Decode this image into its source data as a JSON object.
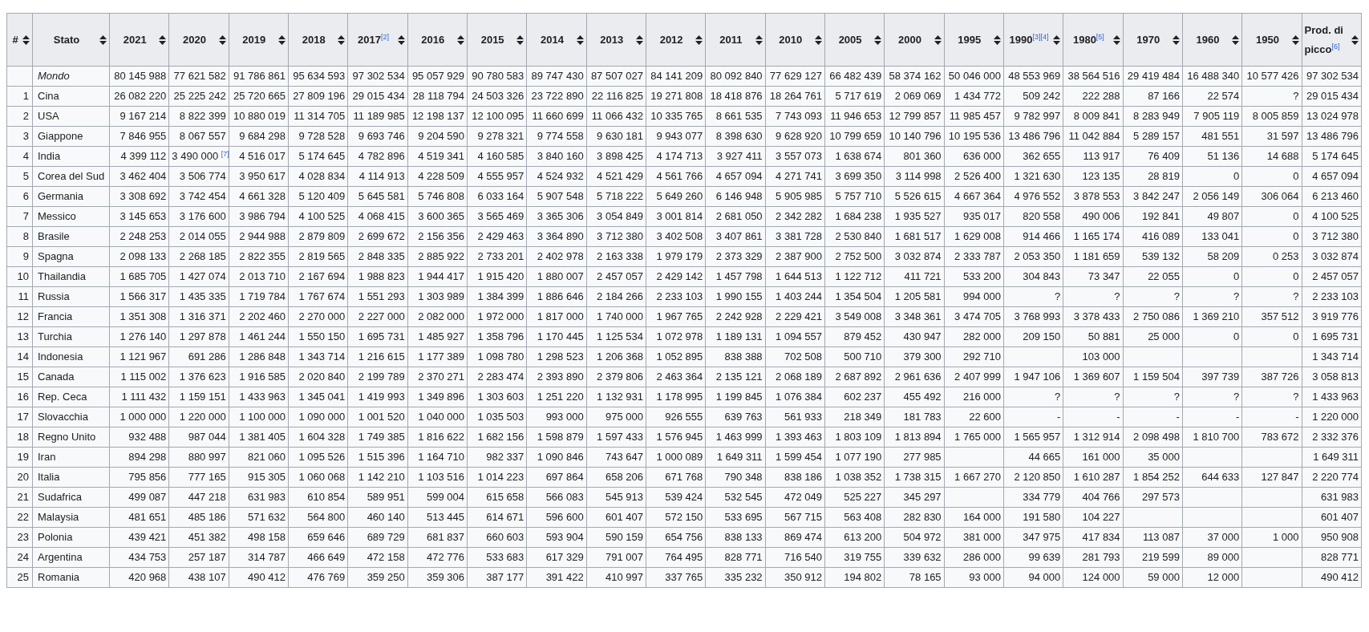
{
  "table": {
    "columns": [
      "#",
      "Stato",
      "2021",
      "2020",
      "2019",
      "2018",
      "2017$^{[2]}$",
      "2016",
      "2015",
      "2014",
      "2013",
      "2012",
      "2011",
      "2010",
      "2005",
      "2000",
      "1995",
      "1990$^{[3][4]}$",
      "1980$^{[5]}$",
      "1970",
      "1960",
      "1950",
      "Prod. di picco$^{[6]}$"
    ],
    "rows": [
      {
        "kind": "total",
        "country": "Mondo",
        "values": {
          "0": "80 145 988",
          "1": "77 621 582",
          "2": "91 786 861",
          "3": "95 634 593",
          "4": "97 302 534",
          "5": "95 057 929",
          "6": "90 780 583",
          "7": "89 747 430",
          "8": "87 507 027",
          "9": "84 141 209",
          "10": "80 092 840",
          "11": "77 629 127",
          "12": "66 482 439",
          "13": "58 374 162",
          "14": "50 046 000",
          "15": "48 553 969",
          "16": "38 564 516",
          "17": "29 419 484",
          "18": "16 488 340",
          "19": "10 577 426",
          "20": "97 302 534"
        }
      },
      {
        "kind": "country",
        "rank": "1",
        "country": "Cina",
        "values": {
          "0": "26 082 220",
          "1": "25 225 242",
          "2": "25 720 665",
          "3": "27 809 196",
          "4": "29 015 434",
          "5": "28 118 794",
          "6": "24 503 326",
          "7": "23 722 890",
          "8": "22 116 825",
          "9": "19 271 808",
          "10": "18 418 876",
          "11": "18 264 761",
          "12": "5 717 619",
          "13": "2 069 069",
          "14": "1 434 772",
          "15": "509 242",
          "16": "222 288",
          "17": "87 166",
          "18": "22 574",
          "19": "?",
          "20": "29 015 434"
        }
      },
      {
        "kind": "country",
        "rank": "2",
        "country": "USA",
        "values": {
          "0": "9 167 214",
          "1": "8 822 399",
          "2": "10 880 019",
          "3": "11 314 705",
          "4": "11 189 985",
          "5": "12 198 137",
          "6": "12 100 095",
          "7": "11 660 699",
          "8": "11 066 432",
          "9": "10 335 765",
          "10": "8 661 535",
          "11": "7 743 093",
          "12": "11 946 653",
          "13": "12 799 857",
          "14": "11 985 457",
          "15": "9 782 997",
          "16": "8 009 841",
          "17": "8 283 949",
          "18": "7 905 119",
          "19": "8 005 859",
          "20": "13 024 978"
        }
      },
      {
        "kind": "country",
        "rank": "3",
        "country": "Giappone",
        "values": {
          "0": "7 846 955",
          "1": "8 067 557",
          "2": "9 684 298",
          "3": "9 728 528",
          "4": "9 693 746",
          "5": "9 204 590",
          "6": "9 278 321",
          "7": "9 774 558",
          "8": "9 630 181",
          "9": "9 943 077",
          "10": "8 398 630",
          "11": "9 628 920",
          "12": "10 799 659",
          "13": "10 140 796",
          "14": "10 195 536",
          "15": "13 486 796",
          "16": "11 042 884",
          "17": "5 289 157",
          "18": "481 551",
          "19": "31 597",
          "20": "13 486 796"
        }
      },
      {
        "kind": "country",
        "rank": "4",
        "country": "India",
        "values": {
          "0": "4 399 112",
          "1": "3 490 000 $^{[7]}$",
          "2": "4 516 017",
          "3": "5 174 645",
          "4": "4 782 896",
          "5": "4 519 341",
          "6": "4 160 585",
          "7": "3 840 160",
          "8": "3 898 425",
          "9": "4 174 713",
          "10": "3 927 411",
          "11": "3 557 073",
          "12": "1 638 674",
          "13": "801 360",
          "14": "636 000",
          "15": "362 655",
          "16": "113 917",
          "17": "76 409",
          "18": "51 136",
          "19": "14 688",
          "20": "5 174 645"
        }
      },
      {
        "kind": "country",
        "rank": "5",
        "country": "Corea del Sud",
        "values": {
          "0": "3 462 404",
          "1": "3 506 774",
          "2": "3 950 617",
          "3": "4 028 834",
          "4": "4 114 913",
          "5": "4 228 509",
          "6": "4 555 957",
          "7": "4 524 932",
          "8": "4 521 429",
          "9": "4 561 766",
          "10": "4 657 094",
          "11": "4 271 741",
          "12": "3 699 350",
          "13": "3 114 998",
          "14": "2 526 400",
          "15": "1 321 630",
          "16": "123 135",
          "17": "28 819",
          "18": "0",
          "19": "0",
          "20": "4 657 094"
        }
      },
      {
        "kind": "country",
        "rank": "6",
        "country": "Germania",
        "values": {
          "0": "3 308 692",
          "1": "3 742 454",
          "2": "4 661 328",
          "3": "5 120 409",
          "4": "5 645 581",
          "5": "5 746 808",
          "6": "6 033 164",
          "7": "5 907 548",
          "8": "5 718 222",
          "9": "5 649 260",
          "10": "6 146 948",
          "11": "5 905 985",
          "12": "5 757 710",
          "13": "5 526 615",
          "14": "4 667 364",
          "15": "4 976 552",
          "16": "3 878 553",
          "17": "3 842 247",
          "18": "2 056 149",
          "19": "306 064",
          "20": "6 213 460"
        }
      },
      {
        "kind": "country",
        "rank": "7",
        "country": "Messico",
        "values": {
          "0": "3 145 653",
          "1": "3 176 600",
          "2": "3 986 794",
          "3": "4 100 525",
          "4": "4 068 415",
          "5": "3 600 365",
          "6": "3 565 469",
          "7": "3 365 306",
          "8": "3 054 849",
          "9": "3 001 814",
          "10": "2 681 050",
          "11": "2 342 282",
          "12": "1 684 238",
          "13": "1 935 527",
          "14": "935 017",
          "15": "820 558",
          "16": "490 006",
          "17": "192 841",
          "18": "49 807",
          "19": "0",
          "20": "4 100 525"
        }
      },
      {
        "kind": "country",
        "rank": "8",
        "country": "Brasile",
        "values": {
          "0": "2 248 253",
          "1": "2 014 055",
          "2": "2 944 988",
          "3": "2 879 809",
          "4": "2 699 672",
          "5": "2 156 356",
          "6": "2 429 463",
          "7": "3 364 890",
          "8": "3 712 380",
          "9": "3 402 508",
          "10": "3 407 861",
          "11": "3 381 728",
          "12": "2 530 840",
          "13": "1 681 517",
          "14": "1 629 008",
          "15": "914 466",
          "16": "1 165 174",
          "17": "416 089",
          "18": "133 041",
          "19": "0",
          "20": "3 712 380"
        }
      },
      {
        "kind": "country",
        "rank": "9",
        "country": "Spagna",
        "values": {
          "0": "2 098 133",
          "1": "2 268 185",
          "2": "2 822 355",
          "3": "2 819 565",
          "4": "2 848 335",
          "5": "2 885 922",
          "6": "2 733 201",
          "7": "2 402 978",
          "8": "2 163 338",
          "9": "1 979 179",
          "10": "2 373 329",
          "11": "2 387 900",
          "12": "2 752 500",
          "13": "3 032 874",
          "14": "2 333 787",
          "15": "2 053 350",
          "16": "1 181 659",
          "17": "539 132",
          "18": "58 209",
          "19": "0 253",
          "20": "3 032 874"
        }
      },
      {
        "kind": "country",
        "rank": "10",
        "country": "Thailandia",
        "values": {
          "0": "1 685 705",
          "1": "1 427 074",
          "2": "2 013 710",
          "3": "2 167 694",
          "4": "1 988 823",
          "5": "1 944 417",
          "6": "1 915 420",
          "7": "1 880 007",
          "8": "2 457 057",
          "9": "2 429 142",
          "10": "1 457 798",
          "11": "1 644 513",
          "12": "1 122 712",
          "13": "411 721",
          "14": "533 200",
          "15": "304 843",
          "16": "73 347",
          "17": "22 055",
          "18": "0",
          "19": "0",
          "20": "2 457 057"
        }
      },
      {
        "kind": "country",
        "rank": "11",
        "country": "Russia",
        "values": {
          "0": "1 566 317",
          "1": "1 435 335",
          "2": "1 719 784",
          "3": "1 767 674",
          "4": "1 551 293",
          "5": "1 303 989",
          "6": "1 384 399",
          "7": "1 886 646",
          "8": "2 184 266",
          "9": "2 233 103",
          "10": "1 990 155",
          "11": "1 403 244",
          "12": "1 354 504",
          "13": "1 205 581",
          "14": "994 000",
          "15": "?",
          "16": "?",
          "17": "?",
          "18": "?",
          "19": "?",
          "20": "2 233 103"
        }
      },
      {
        "kind": "country",
        "rank": "12",
        "country": "Francia",
        "values": {
          "0": "1 351 308",
          "1": "1 316 371",
          "2": "2 202 460",
          "3": "2 270 000",
          "4": "2 227 000",
          "5": "2 082 000",
          "6": "1 972 000",
          "7": "1 817 000",
          "8": "1 740 000",
          "9": "1 967 765",
          "10": "2 242 928",
          "11": "2 229 421",
          "12": "3 549 008",
          "13": "3 348 361",
          "14": "3 474 705",
          "15": "3 768 993",
          "16": "3 378 433",
          "17": "2 750 086",
          "18": "1 369 210",
          "19": "357 512",
          "20": "3 919 776"
        }
      },
      {
        "kind": "country",
        "rank": "13",
        "country": "Turchia",
        "values": {
          "0": "1 276 140",
          "1": "1 297 878",
          "2": "1 461 244",
          "3": "1 550 150",
          "4": "1 695 731",
          "5": "1 485 927",
          "6": "1 358 796",
          "7": "1 170 445",
          "8": "1 125 534",
          "9": "1 072 978",
          "10": "1 189 131",
          "11": "1 094 557",
          "12": "879 452",
          "13": "430 947",
          "14": "282 000",
          "15": "209 150",
          "16": "50 881",
          "17": "25 000",
          "18": "0",
          "19": "0",
          "20": "1 695 731"
        }
      },
      {
        "kind": "country",
        "rank": "14",
        "country": "Indonesia",
        "values": {
          "0": "1 121 967",
          "1": "691 286",
          "2": "1 286 848",
          "3": "1 343 714",
          "4": "1 216 615",
          "5": "1 177 389",
          "6": "1 098 780",
          "7": "1 298 523",
          "8": "1 206 368",
          "9": "1 052 895",
          "10": "838 388",
          "11": "702 508",
          "12": "500 710",
          "13": "379 300",
          "14": "292 710",
          "16": "103 000",
          "20": "1 343 714"
        }
      },
      {
        "kind": "country",
        "rank": "15",
        "country": "Canada",
        "values": {
          "0": "1 115 002",
          "1": "1 376 623",
          "2": "1 916 585",
          "3": "2 020 840",
          "4": "2 199 789",
          "5": "2 370 271",
          "6": "2 283 474",
          "7": "2 393 890",
          "8": "2 379 806",
          "9": "2 463 364",
          "10": "2 135 121",
          "11": "2 068 189",
          "12": "2 687 892",
          "13": "2 961 636",
          "14": "2 407 999",
          "15": "1 947 106",
          "16": "1 369 607",
          "17": "1 159 504",
          "18": "397 739",
          "19": "387 726",
          "20": "3 058 813"
        }
      },
      {
        "kind": "country",
        "rank": "16",
        "country": "Rep. Ceca",
        "values": {
          "0": "1 111 432",
          "1": "1 159 151",
          "2": "1 433 963",
          "3": "1 345 041",
          "4": "1 419 993",
          "5": "1 349 896",
          "6": "1 303 603",
          "7": "1 251 220",
          "8": "1 132 931",
          "9": "1 178 995",
          "10": "1 199 845",
          "11": "1 076 384",
          "12": "602 237",
          "13": "455 492",
          "14": "216 000",
          "15": "?",
          "16": "?",
          "17": "?",
          "18": "?",
          "19": "?",
          "20": "1 433 963"
        }
      },
      {
        "kind": "country",
        "rank": "17",
        "country": "Slovacchia",
        "values": {
          "0": "1 000 000",
          "1": "1 220 000",
          "2": "1 100 000",
          "3": "1 090 000",
          "4": "1 001 520",
          "5": "1 040 000",
          "6": "1 035 503",
          "7": "993 000",
          "8": "975 000",
          "9": "926 555",
          "10": "639 763",
          "11": "561 933",
          "12": "218 349",
          "13": "181 783",
          "14": "22 600",
          "15": "-",
          "16": "-",
          "17": "-",
          "18": "-",
          "19": "-",
          "20": "1 220 000"
        }
      },
      {
        "kind": "country",
        "rank": "18",
        "country": "Regno Unito",
        "values": {
          "0": "932 488",
          "1": "987 044",
          "2": "1 381 405",
          "3": "1 604 328",
          "4": "1 749 385",
          "5": "1 816 622",
          "6": "1 682 156",
          "7": "1 598 879",
          "8": "1 597 433",
          "9": "1 576 945",
          "10": "1 463 999",
          "11": "1 393 463",
          "12": "1 803 109",
          "13": "1 813 894",
          "14": "1 765 000",
          "15": "1 565 957",
          "16": "1 312 914",
          "17": "2 098 498",
          "18": "1 810 700",
          "19": "783 672",
          "20": "2 332 376"
        }
      },
      {
        "kind": "country",
        "rank": "19",
        "country": "Iran",
        "values": {
          "0": "894 298",
          "1": "880 997",
          "2": "821 060",
          "3": "1 095 526",
          "4": "1 515 396",
          "5": "1 164 710",
          "6": "982 337",
          "7": "1 090 846",
          "8": "743 647",
          "9": "1 000 089",
          "10": "1 649 311",
          "11": "1 599 454",
          "12": "1 077 190",
          "13": "277 985",
          "15": "44 665",
          "16": "161 000",
          "17": "35 000",
          "20": "1 649 311"
        }
      },
      {
        "kind": "country",
        "rank": "20",
        "country": "Italia",
        "values": {
          "0": "795 856",
          "1": "777 165",
          "2": "915 305",
          "3": "1 060 068",
          "4": "1 142 210",
          "5": "1 103 516",
          "6": "1 014 223",
          "7": "697 864",
          "8": "658 206",
          "9": "671 768",
          "10": "790 348",
          "11": "838 186",
          "12": "1 038 352",
          "13": "1 738 315",
          "14": "1 667 270",
          "15": "2 120 850",
          "16": "1 610 287",
          "17": "1 854 252",
          "18": "644 633",
          "19": "127 847",
          "20": "2 220 774"
        }
      },
      {
        "kind": "country",
        "rank": "21",
        "country": "Sudafrica",
        "values": {
          "0": "499 087",
          "1": "447 218",
          "2": "631 983",
          "3": "610 854",
          "4": "589 951",
          "5": "599 004",
          "6": "615 658",
          "7": "566 083",
          "8": "545 913",
          "9": "539 424",
          "10": "532 545",
          "11": "472 049",
          "12": "525 227",
          "13": "345 297",
          "15": "334 779",
          "16": "404 766",
          "17": "297 573",
          "20": "631 983"
        }
      },
      {
        "kind": "country",
        "rank": "22",
        "country": "Malaysia",
        "values": {
          "0": "481 651",
          "1": "485 186",
          "2": "571 632",
          "3": "564 800",
          "4": "460 140",
          "5": "513 445",
          "6": "614 671",
          "7": "596 600",
          "8": "601 407",
          "9": "572 150",
          "10": "533 695",
          "11": "567 715",
          "12": "563 408",
          "13": "282 830",
          "14": "164 000",
          "15": "191 580",
          "16": "104 227",
          "20": "601 407"
        }
      },
      {
        "kind": "country",
        "rank": "23",
        "country": "Polonia",
        "values": {
          "0": "439 421",
          "1": "451 382",
          "2": "498 158",
          "3": "659 646",
          "4": "689 729",
          "5": "681 837",
          "6": "660 603",
          "7": "593 904",
          "8": "590 159",
          "9": "654 756",
          "10": "838 133",
          "11": "869 474",
          "12": "613 200",
          "13": "504 972",
          "14": "381 000",
          "15": "347 975",
          "16": "417 834",
          "17": "113 087",
          "18": "37 000",
          "19": "1 000",
          "20": "950 908"
        }
      },
      {
        "kind": "country",
        "rank": "24",
        "country": "Argentina",
        "values": {
          "0": "434 753",
          "1": "257 187",
          "2": "314 787",
          "3": "466 649",
          "4": "472 158",
          "5": "472 776",
          "6": "533 683",
          "7": "617 329",
          "8": "791 007",
          "9": "764 495",
          "10": "828 771",
          "11": "716 540",
          "12": "319 755",
          "13": "339 632",
          "14": "286 000",
          "15": "99 639",
          "16": "281 793",
          "17": "219 599",
          "18": "89 000",
          "20": "828 771"
        }
      },
      {
        "kind": "country",
        "rank": "25",
        "country": "Romania",
        "values": {
          "0": "420 968",
          "1": "438 107",
          "2": "490 412",
          "3": "476 769",
          "4": "359 250",
          "5": "359 306",
          "6": "387 177",
          "7": "391 422",
          "8": "410 997",
          "9": "337 765",
          "10": "335 232",
          "11": "350 912",
          "12": "194 802",
          "13": "78 165",
          "14": "93 000",
          "15": "94 000",
          "16": "124 000",
          "17": "59 000",
          "18": "12 000",
          "20": "490 412"
        }
      }
    ]
  }
}
